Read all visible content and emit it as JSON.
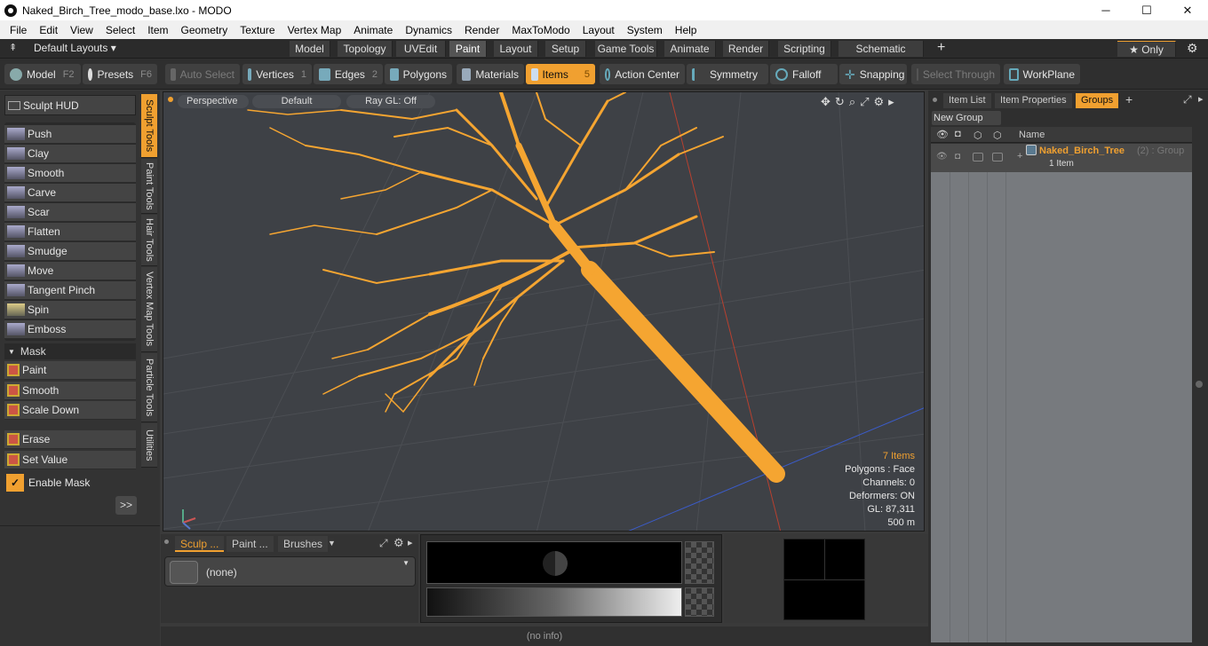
{
  "window": {
    "title": "Naked_Birch_Tree_modo_base.lxo - MODO",
    "minimize": "─",
    "maximize": "☐",
    "close": "✕"
  },
  "menu": [
    "File",
    "Edit",
    "View",
    "Select",
    "Item",
    "Geometry",
    "Texture",
    "Vertex Map",
    "Animate",
    "Dynamics",
    "Render",
    "MaxToModo",
    "Layout",
    "System",
    "Help"
  ],
  "layoutbar": {
    "layouts_label": "Default Layouts ▾",
    "tabs": [
      "Model",
      "Topology",
      "UVEdit",
      "Paint",
      "Layout",
      "Setup",
      "Game Tools",
      "Animate",
      "Render",
      "Scripting",
      "Schematic Fusion"
    ],
    "active_tab": "Paint",
    "plus": "+",
    "only_label": "★  Only",
    "gear": "⚙"
  },
  "toolbar": {
    "model": "Model",
    "model_key": "F2",
    "presets": "Presets",
    "presets_key": "F6",
    "auto_select": "Auto Select",
    "vertices": "Vertices",
    "vertices_key": "1",
    "edges": "Edges",
    "edges_key": "2",
    "polygons": "Polygons",
    "materials": "Materials",
    "items": "Items",
    "items_key": "5",
    "action_center": "Action Center",
    "symmetry": "Symmetry",
    "falloff": "Falloff",
    "snapping": "Snapping",
    "select_through": "Select Through",
    "workplane": "WorkPlane"
  },
  "left": {
    "sculpt_hud": "Sculpt HUD",
    "tools": [
      "Push",
      "Clay",
      "Smooth",
      "Carve",
      "Scar",
      "Flatten",
      "Smudge",
      "Move",
      "Tangent Pinch",
      "Spin",
      "Emboss"
    ],
    "mask_header": "Mask",
    "mask_tools": [
      "Paint",
      "Smooth",
      "Scale Down"
    ],
    "extra_tools": [
      "Erase",
      "Set Value"
    ],
    "enable_mask": "Enable Mask",
    "more": ">>",
    "vtabs": [
      "Sculpt Tools",
      "Paint Tools",
      "Hair Tools",
      "Vertex Map Tools",
      "Particle Tools",
      "Utilities"
    ]
  },
  "viewport": {
    "view": "Perspective",
    "shading": "Default",
    "raygl": "Ray GL: Off",
    "stats": [
      "7 Items",
      "Polygons : Face",
      "Channels: 0",
      "Deformers: ON",
      "GL: 87,311",
      "500 m"
    ]
  },
  "bottom": {
    "tabs": [
      "Sculp ...",
      "Paint ...",
      "Brushes"
    ],
    "preset_value": "(none)",
    "status": "(no info)"
  },
  "right": {
    "tabs": [
      "Item List",
      "Item Properties",
      "Groups"
    ],
    "new_group": "New Group",
    "col_name": "Name",
    "group_name": "Naked_Birch_Tree",
    "group_suffix": "(2) : Group",
    "group_count": "1 Item"
  },
  "colors": {
    "accent": "#f0a030",
    "tree": "#f5a531",
    "viewport": "#3e4146"
  }
}
